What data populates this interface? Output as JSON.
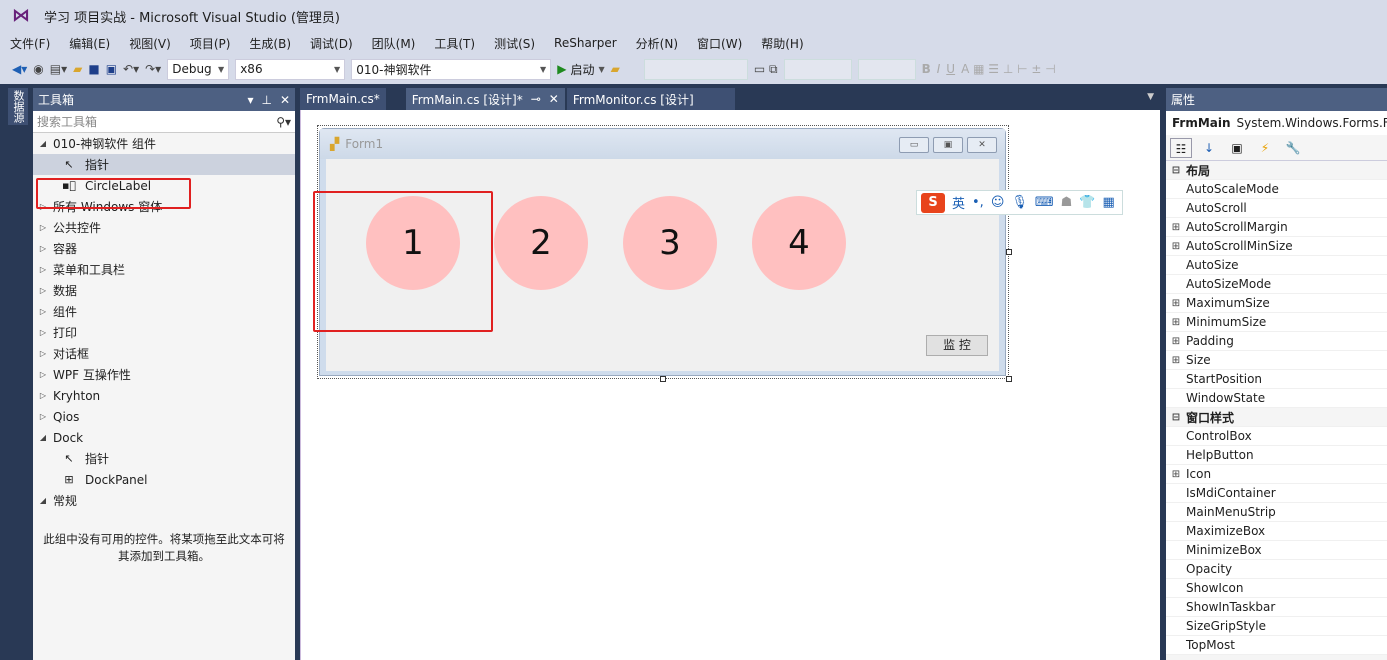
{
  "window": {
    "title": "学习 项目实战 - Microsoft Visual Studio (管理员)"
  },
  "menu": [
    "文件(F)",
    "编辑(E)",
    "视图(V)",
    "项目(P)",
    "生成(B)",
    "调试(D)",
    "团队(M)",
    "工具(T)",
    "测试(S)",
    "ReSharper",
    "分析(N)",
    "窗口(W)",
    "帮助(H)"
  ],
  "toolbar": {
    "config": "Debug",
    "platform": "x86",
    "project": "010-神钢软件",
    "start_label": "启动"
  },
  "left_strip": {
    "label": "数据源"
  },
  "toolbox": {
    "title": "工具箱",
    "search_placeholder": "搜索工具箱",
    "groups": [
      {
        "label": "010-神钢软件 组件",
        "expanded": true,
        "items": [
          {
            "label": "指针",
            "icon": "pointer-icon",
            "selected": true
          },
          {
            "label": "CircleLabel",
            "icon": "component-icon",
            "highlighted": true
          }
        ]
      },
      {
        "label": "所有 Windows 窗体"
      },
      {
        "label": "公共控件"
      },
      {
        "label": "容器"
      },
      {
        "label": "菜单和工具栏"
      },
      {
        "label": "数据"
      },
      {
        "label": "组件"
      },
      {
        "label": "打印"
      },
      {
        "label": "对话框"
      },
      {
        "label": "WPF 互操作性"
      },
      {
        "label": "Kryhton"
      },
      {
        "label": "Qios"
      },
      {
        "label": "Dock",
        "expanded": true,
        "items": [
          {
            "label": "指针",
            "icon": "pointer-icon"
          },
          {
            "label": "DockPanel",
            "icon": "dockpanel-icon"
          }
        ]
      },
      {
        "label": "常规",
        "expanded": true,
        "items": []
      }
    ],
    "empty_message": "此组中没有可用的控件。将某项拖至此文本可将其添加到工具箱。"
  },
  "tabs": [
    {
      "label": "FrmMain.cs*",
      "active": false
    },
    {
      "label": "FrmMain.cs [设计]*",
      "active": true
    },
    {
      "label": "FrmMonitor.cs [设计]",
      "active": false
    }
  ],
  "form": {
    "title": "Form1",
    "circles": [
      "1",
      "2",
      "3",
      "4"
    ],
    "circle_color": "#ffc0c0",
    "button_label": "监 控"
  },
  "ime": {
    "logo": "S",
    "mode": "英"
  },
  "properties": {
    "title": "属性",
    "object_name": "FrmMain",
    "object_type": "System.Windows.Forms.Form",
    "rows": [
      {
        "name": "布局",
        "category": true
      },
      {
        "name": "AutoScaleMode"
      },
      {
        "name": "AutoScroll"
      },
      {
        "name": "AutoScrollMargin",
        "expandable": true
      },
      {
        "name": "AutoScrollMinSize",
        "expandable": true
      },
      {
        "name": "AutoSize"
      },
      {
        "name": "AutoSizeMode"
      },
      {
        "name": "MaximumSize",
        "expandable": true
      },
      {
        "name": "MinimumSize",
        "expandable": true
      },
      {
        "name": "Padding",
        "expandable": true
      },
      {
        "name": "Size",
        "expandable": true
      },
      {
        "name": "StartPosition"
      },
      {
        "name": "WindowState"
      },
      {
        "name": "窗口样式",
        "category": true
      },
      {
        "name": "ControlBox"
      },
      {
        "name": "HelpButton"
      },
      {
        "name": "Icon",
        "expandable": true
      },
      {
        "name": "IsMdiContainer"
      },
      {
        "name": "MainMenuStrip"
      },
      {
        "name": "MaximizeBox"
      },
      {
        "name": "MinimizeBox"
      },
      {
        "name": "Opacity"
      },
      {
        "name": "ShowIcon"
      },
      {
        "name": "ShowInTaskbar"
      },
      {
        "name": "SizeGripStyle"
      },
      {
        "name": "TopMost"
      }
    ]
  },
  "colors": {
    "highlight": "#e02020",
    "panel_header": "#4d6082",
    "background": "#293955"
  }
}
